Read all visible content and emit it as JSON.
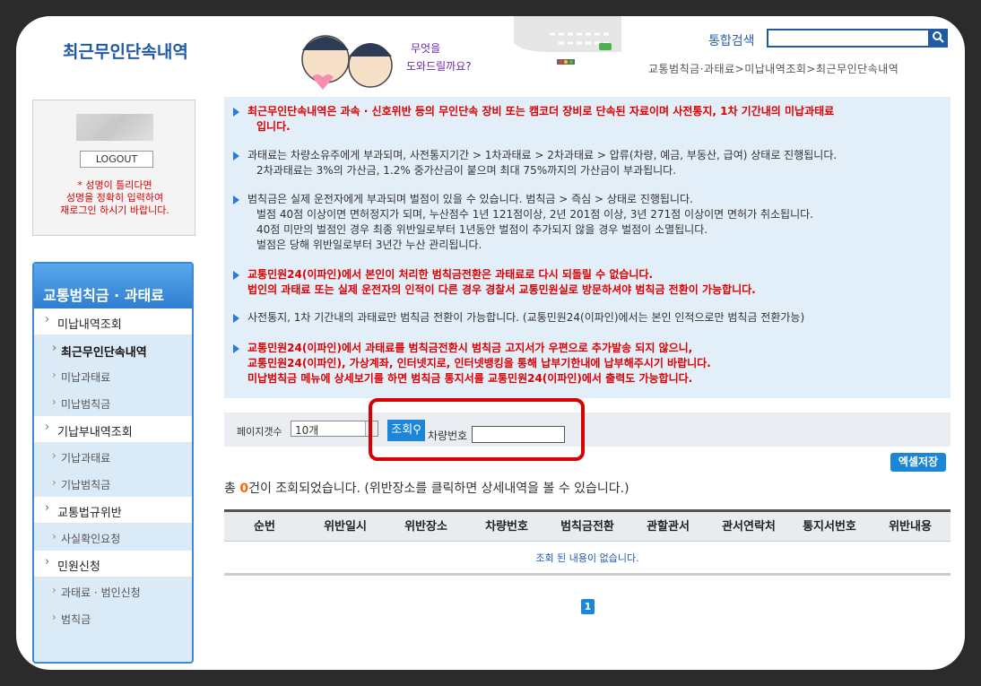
{
  "header": {
    "title": "최근무인단속내역",
    "banner_text": "무엇을 도와드릴까요?",
    "search_label": "통합검색",
    "search_value": "",
    "breadcrumb": "교통범칙금·과태료>미납내역조회>최근무인단속내역"
  },
  "login": {
    "logout_label": "LOGOUT",
    "message": [
      "* 성명이 틀리다면",
      "성명을 정확히 입력하여",
      "재로그인 하시기 바랍니다."
    ]
  },
  "sidebar": {
    "heading": "교통범칙금 · 과태료",
    "items": [
      {
        "label": "미납내역조회",
        "children": [
          "최근무인단속내역",
          "미납과태료",
          "미납범칙금"
        ]
      },
      {
        "label": "기납부내역조회",
        "children": [
          "기납과태료",
          "기납범칙금"
        ]
      },
      {
        "label": "교통법규위반",
        "children": [
          "사실확인요청"
        ]
      },
      {
        "label": "민원신청",
        "children": [
          "과태료 · 범인신청",
          "범칙금"
        ]
      }
    ],
    "active": "최근무인단속내역"
  },
  "notice": {
    "p1": [
      "최근무인단속내역은 과속 · 신호위반 등의 무인단속 장비 또는 캠코더 장비로 단속된 자료이며 사전통지, 1차 기간내의 미납과태료",
      "입니다."
    ],
    "p2": [
      "과태료는 차량소유주에게 부과되며, 사전통지기간 > 1차과태료 > 2차과태료 > 압류(차량, 예금, 부동산, 급여) 상태로 진행됩니다.",
      "2차과태료는 3%의 가산금, 1.2% 중가산금이 붙으며 최대 75%까지의 가산금이 부과됩니다."
    ],
    "p3": [
      "범칙금은 실제 운전자에게 부과되며 벌점이 있을 수 있습니다. 범칙금 > 즉심 > 상태로 진행됩니다.",
      "벌점 40점 이상이면 면허정지가 되며, 누산점수 1년 121점이상, 2년 201점 이상, 3년 271점 이상이면 면허가 취소됩니다.",
      "40점 미만의 벌점인 경우 최종 위반일로부터 1년동안 벌점이 추가되지 않을 경우 벌점이 소멸됩니다.",
      "벌점은 당해 위반일로부터 3년간 누산 관리됩니다."
    ],
    "p4": [
      "교통민원24(이파인)에서 본인이 처리한 범칙금전환은 과태료로 다시 되돌릴 수 없습니다.",
      "법인의 과태료 또는 실제 운전자의 인적이 다른 경우 경찰서 교통민원실로 방문하셔야 범칙금 전환이 가능합니다."
    ],
    "p5": "사전통지, 1차 기간내의 과태료만 범칙금 전환이 가능합니다. (교통민원24(이파인)에서는 본인 인적으로만 범칙금 전환가능)",
    "p6": [
      "교통민원24(이파인)에서 과태료를 범칙금전환시 범칙금 고지서가 우편으로 추가발송 되지 않으니,",
      "교통민원24(이파인), 가상계좌, 인터넷지로, 인터넷뱅킹을 통해 납부기한내에 납부해주시기 바랍니다.",
      "미납범칙금 메뉴에 상세보기를 하면 범칙금 통지서를 교통민원24(이파인)에서 출력도 가능합니다."
    ]
  },
  "filter": {
    "page_count_label": "페이지갯수",
    "page_count_value": "10개",
    "query_label": "조회",
    "plate_label": "차량번호",
    "plate_value": ""
  },
  "excel_label": "엑셀저장",
  "result": {
    "prefix": "총 ",
    "count": "0",
    "suffix": "건이 조회되었습니다. (위반장소를 클릭하면 상세내역을 볼 수 있습니다.)"
  },
  "table": {
    "columns": [
      "순번",
      "위반일시",
      "위반장소",
      "차량번호",
      "범칙금전환",
      "관할관서",
      "관서연락처",
      "통지서번호",
      "위반내용"
    ],
    "empty_text": "조회 된 내용이 없습니다."
  },
  "pagination": {
    "current": "1"
  },
  "colors": {
    "brand": "#1f5aa6",
    "button": "#1b86d8",
    "alert": "#e00000",
    "highlight": "#d80000"
  }
}
